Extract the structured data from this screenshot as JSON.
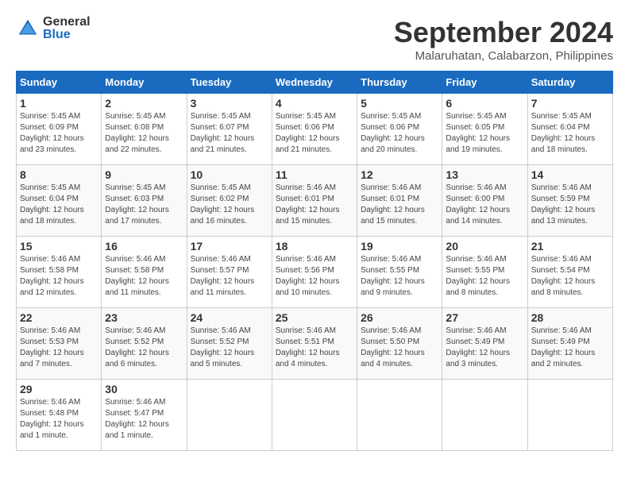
{
  "logo": {
    "general": "General",
    "blue": "Blue"
  },
  "title": "September 2024",
  "location": "Malaruhatan, Calabarzon, Philippines",
  "days_of_week": [
    "Sunday",
    "Monday",
    "Tuesday",
    "Wednesday",
    "Thursday",
    "Friday",
    "Saturday"
  ],
  "weeks": [
    [
      {
        "day": "1",
        "sunrise": "5:45 AM",
        "sunset": "6:09 PM",
        "daylight": "12 hours and 23 minutes."
      },
      {
        "day": "2",
        "sunrise": "5:45 AM",
        "sunset": "6:08 PM",
        "daylight": "12 hours and 22 minutes."
      },
      {
        "day": "3",
        "sunrise": "5:45 AM",
        "sunset": "6:07 PM",
        "daylight": "12 hours and 21 minutes."
      },
      {
        "day": "4",
        "sunrise": "5:45 AM",
        "sunset": "6:06 PM",
        "daylight": "12 hours and 21 minutes."
      },
      {
        "day": "5",
        "sunrise": "5:45 AM",
        "sunset": "6:06 PM",
        "daylight": "12 hours and 20 minutes."
      },
      {
        "day": "6",
        "sunrise": "5:45 AM",
        "sunset": "6:05 PM",
        "daylight": "12 hours and 19 minutes."
      },
      {
        "day": "7",
        "sunrise": "5:45 AM",
        "sunset": "6:04 PM",
        "daylight": "12 hours and 18 minutes."
      }
    ],
    [
      {
        "day": "8",
        "sunrise": "5:45 AM",
        "sunset": "6:04 PM",
        "daylight": "12 hours and 18 minutes."
      },
      {
        "day": "9",
        "sunrise": "5:45 AM",
        "sunset": "6:03 PM",
        "daylight": "12 hours and 17 minutes."
      },
      {
        "day": "10",
        "sunrise": "5:45 AM",
        "sunset": "6:02 PM",
        "daylight": "12 hours and 16 minutes."
      },
      {
        "day": "11",
        "sunrise": "5:46 AM",
        "sunset": "6:01 PM",
        "daylight": "12 hours and 15 minutes."
      },
      {
        "day": "12",
        "sunrise": "5:46 AM",
        "sunset": "6:01 PM",
        "daylight": "12 hours and 15 minutes."
      },
      {
        "day": "13",
        "sunrise": "5:46 AM",
        "sunset": "6:00 PM",
        "daylight": "12 hours and 14 minutes."
      },
      {
        "day": "14",
        "sunrise": "5:46 AM",
        "sunset": "5:59 PM",
        "daylight": "12 hours and 13 minutes."
      }
    ],
    [
      {
        "day": "15",
        "sunrise": "5:46 AM",
        "sunset": "5:58 PM",
        "daylight": "12 hours and 12 minutes."
      },
      {
        "day": "16",
        "sunrise": "5:46 AM",
        "sunset": "5:58 PM",
        "daylight": "12 hours and 11 minutes."
      },
      {
        "day": "17",
        "sunrise": "5:46 AM",
        "sunset": "5:57 PM",
        "daylight": "12 hours and 11 minutes."
      },
      {
        "day": "18",
        "sunrise": "5:46 AM",
        "sunset": "5:56 PM",
        "daylight": "12 hours and 10 minutes."
      },
      {
        "day": "19",
        "sunrise": "5:46 AM",
        "sunset": "5:55 PM",
        "daylight": "12 hours and 9 minutes."
      },
      {
        "day": "20",
        "sunrise": "5:46 AM",
        "sunset": "5:55 PM",
        "daylight": "12 hours and 8 minutes."
      },
      {
        "day": "21",
        "sunrise": "5:46 AM",
        "sunset": "5:54 PM",
        "daylight": "12 hours and 8 minutes."
      }
    ],
    [
      {
        "day": "22",
        "sunrise": "5:46 AM",
        "sunset": "5:53 PM",
        "daylight": "12 hours and 7 minutes."
      },
      {
        "day": "23",
        "sunrise": "5:46 AM",
        "sunset": "5:52 PM",
        "daylight": "12 hours and 6 minutes."
      },
      {
        "day": "24",
        "sunrise": "5:46 AM",
        "sunset": "5:52 PM",
        "daylight": "12 hours and 5 minutes."
      },
      {
        "day": "25",
        "sunrise": "5:46 AM",
        "sunset": "5:51 PM",
        "daylight": "12 hours and 4 minutes."
      },
      {
        "day": "26",
        "sunrise": "5:46 AM",
        "sunset": "5:50 PM",
        "daylight": "12 hours and 4 minutes."
      },
      {
        "day": "27",
        "sunrise": "5:46 AM",
        "sunset": "5:49 PM",
        "daylight": "12 hours and 3 minutes."
      },
      {
        "day": "28",
        "sunrise": "5:46 AM",
        "sunset": "5:49 PM",
        "daylight": "12 hours and 2 minutes."
      }
    ],
    [
      {
        "day": "29",
        "sunrise": "5:46 AM",
        "sunset": "5:48 PM",
        "daylight": "12 hours and 1 minute."
      },
      {
        "day": "30",
        "sunrise": "5:46 AM",
        "sunset": "5:47 PM",
        "daylight": "12 hours and 1 minute."
      },
      null,
      null,
      null,
      null,
      null
    ]
  ]
}
